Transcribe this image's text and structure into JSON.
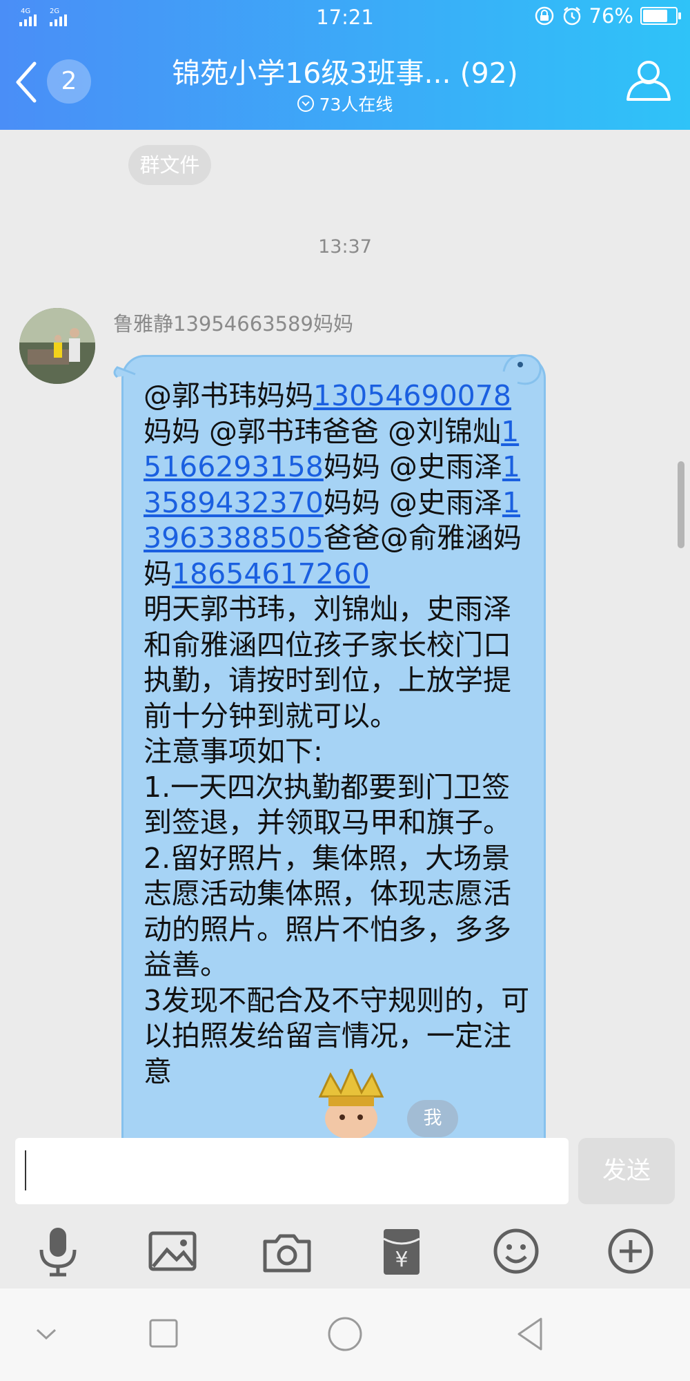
{
  "status_bar": {
    "network_left": "4G",
    "network_right": "2G",
    "time": "17:21",
    "battery": "76%",
    "battery_level": 0.76
  },
  "header": {
    "unread_count": "2",
    "title": "锦苑小学16级3班事... (92)",
    "online": "73人在线",
    "colors": {
      "gradient_start": "#4a8ef7",
      "gradient_end": "#2fc3f8"
    }
  },
  "chat": {
    "file_chip": "群文件",
    "timestamp": "13:37",
    "message": {
      "sender": "鲁雅静13954663589妈妈",
      "segments": [
        {
          "t": "@郭书玮妈妈"
        },
        {
          "t": "13054690078",
          "link": true
        },
        {
          "t": "妈妈 @郭书玮爸爸 @刘锦灿"
        },
        {
          "t": "15166293158",
          "link": true
        },
        {
          "t": "妈妈 @史雨泽"
        },
        {
          "t": "13589432370",
          "link": true
        },
        {
          "t": "妈妈 @史雨泽"
        },
        {
          "t": "13963388505",
          "link": true
        },
        {
          "t": "爸爸@俞雅涵妈妈"
        },
        {
          "t": "18654617260",
          "link": true
        },
        {
          "t": "\n明天郭书玮，刘锦灿，史雨泽和俞雅涵四位孩子家长校门口执勤，请按时到位，上放学提前十分钟到就可以。\n注意事项如下:\n1.一天四次执勤都要到门卫签到签退，并领取马甲和旗子。\n2.留好照片，集体照，大场景志愿活动集体照，体现志愿活动的照片。照片不怕多，多多益善。\n3发现不配合及不守规则的，可以拍照发给"
        },
        {
          "t": "我",
          "hidden": true
        },
        {
          "t": "留言情况，一定注意"
        }
      ],
      "bubble_color": "#a6d3f5",
      "link_color": "#1a5fe0"
    },
    "me_badge": "我"
  },
  "input": {
    "value": "",
    "placeholder": "",
    "send_label": "发送"
  },
  "toolbar": {
    "items": [
      "microphone-icon",
      "image-icon",
      "camera-icon",
      "red-packet-icon",
      "emoji-icon",
      "plus-icon"
    ]
  },
  "navbar": {
    "items": [
      "nav-down-icon",
      "nav-recents-icon",
      "nav-home-icon",
      "nav-back-icon"
    ]
  }
}
